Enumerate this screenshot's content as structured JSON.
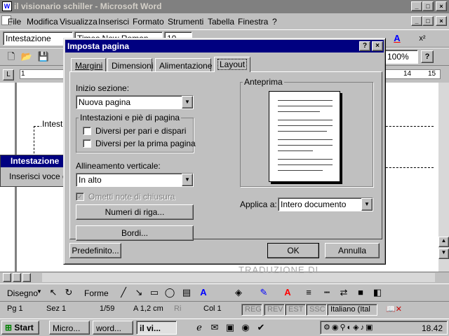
{
  "window": {
    "title": "il visionario schiller - Microsoft Word"
  },
  "menu": [
    "File",
    "Modifica",
    "Visualizza",
    "Inserisci",
    "Formato",
    "Strumenti",
    "Tabella",
    "Finestra",
    "?"
  ],
  "format_toolbar": {
    "style": "Intestazione",
    "font": "Times New Roman",
    "size": "10"
  },
  "standard_toolbar": {
    "zoom": "100%"
  },
  "ruler": {
    "numbers": [
      "1",
      "14",
      "15"
    ]
  },
  "document": {
    "header_label": "Intest"
  },
  "header_toolbar": {
    "title": "Intestazione",
    "insert_label": "Inserisci voce di"
  },
  "dialog": {
    "title": "Imposta pagina",
    "tabs": [
      "Margini",
      "Dimensioni",
      "Alimentazione",
      "Layout"
    ],
    "active_tab": "Layout",
    "section_start_label": "Inizio sezione:",
    "section_start_value": "Nuova pagina",
    "headers_group_label": "Intestazioni e piè di pagina",
    "odd_even_label": "Diversi per pari e dispari",
    "first_page_label": "Diversi per la prima pagina",
    "valign_label": "Allineamento verticale:",
    "valign_value": "In alto",
    "suppress_endnotes_label": "Ometti note di chiusura",
    "line_numbers_label": "Numeri di riga...",
    "borders_label": "Bordi...",
    "preview_label": "Anteprima",
    "apply_to_label": "Applica a:",
    "apply_to_value": "Intero documento",
    "default_label": "Predefinito...",
    "ok_label": "OK",
    "cancel_label": "Annulla"
  },
  "watermark": "TRADUZIONE DI",
  "drawing_toolbar": {
    "draw_label": "Disegno",
    "shapes_label": "Forme"
  },
  "status": {
    "page": "Pg 1",
    "section": "Sez 1",
    "pages": "1/59",
    "at": "A 1,2 cm",
    "ri": "Ri",
    "col": "Col 1",
    "reg": "REG",
    "rev": "REV",
    "est": "EST",
    "ssc": "SSC",
    "language": "Italiano (Ital"
  },
  "taskbar": {
    "start": "Start",
    "buttons": [
      "Micro...",
      "word...",
      "il vi..."
    ],
    "clock": "18.42"
  }
}
